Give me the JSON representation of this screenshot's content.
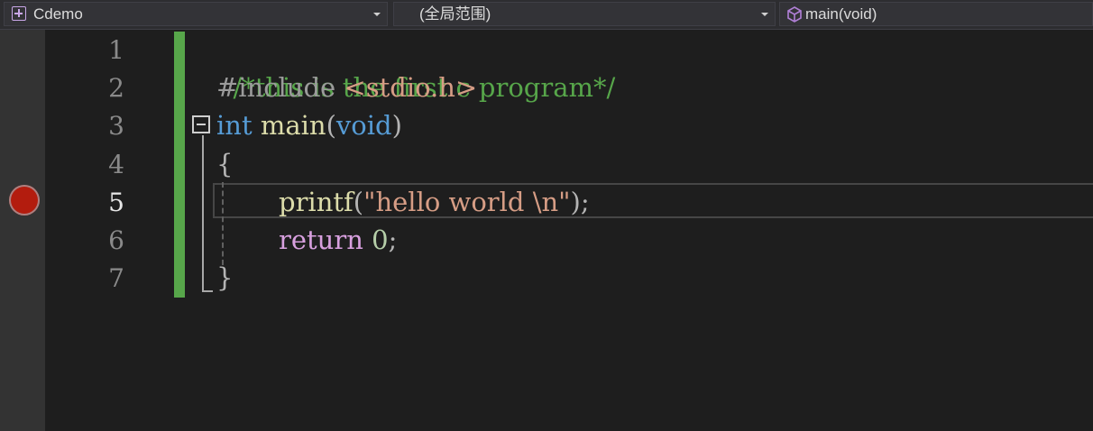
{
  "navbar": {
    "project": "Cdemo",
    "scope": "(全局范围)",
    "member": "main(void)"
  },
  "editor": {
    "line_numbers": [
      "1",
      "2",
      "3",
      "4",
      "5",
      "6",
      "7"
    ],
    "current_line": "5",
    "breakpoint_line": "5",
    "lines": {
      "l1": {
        "comment": "/*this is the first c program*/"
      },
      "l2": {
        "directive": "#include ",
        "header": "<stdio.h>"
      },
      "l3": {
        "type": "int",
        "name": "main",
        "open": "(",
        "param": "void",
        "close": ")"
      },
      "l4": {
        "brace": "{"
      },
      "l5": {
        "func": "printf",
        "open": "(",
        "string": "\"hello world \\n\"",
        "close": ");"
      },
      "l6": {
        "keyword": "return",
        "value": "0",
        "semi": ";"
      },
      "l7": {
        "brace": "}"
      }
    }
  },
  "colors": {
    "background": "#1e1e1e",
    "comment": "#57a64a",
    "keyword": "#569cd6",
    "string": "#d69d85",
    "control": "#d8a0df",
    "breakpoint": "#e51400",
    "change_bar": "#57a64a"
  },
  "icons": {
    "project": "cpp-project-icon",
    "member": "method-cube-icon"
  }
}
